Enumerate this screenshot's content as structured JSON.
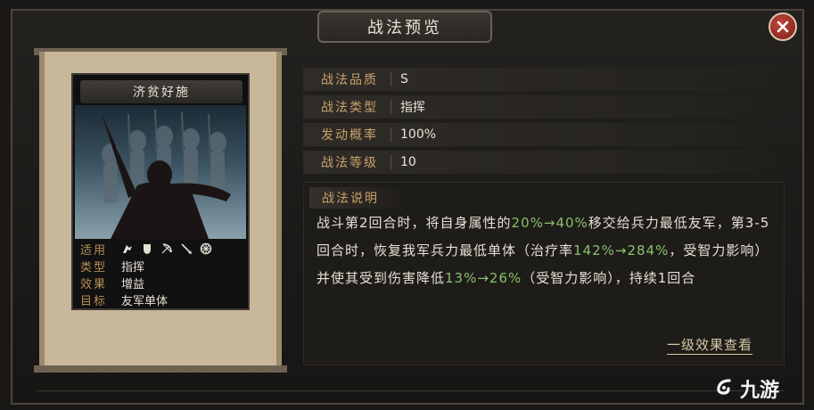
{
  "window": {
    "title": "战法预览"
  },
  "card": {
    "name": "济贫好施",
    "info": [
      {
        "key": "适用",
        "value": ""
      },
      {
        "key": "类型",
        "value": "指挥"
      },
      {
        "key": "效果",
        "value": "增益"
      },
      {
        "key": "目标",
        "value": "友军单体"
      }
    ],
    "applicable_icons": [
      "cavalry-icon",
      "shield-icon",
      "bow-icon",
      "spear-icon",
      "wheel-icon"
    ]
  },
  "details": [
    {
      "label": "战法品质",
      "value": "S"
    },
    {
      "label": "战法类型",
      "value": "指挥"
    },
    {
      "label": "发动概率",
      "value": "100%"
    },
    {
      "label": "战法等级",
      "value": "10"
    }
  ],
  "description": {
    "title": "战法说明",
    "segments": [
      {
        "t": "战斗第2回合时，将自身属性的",
        "g": false
      },
      {
        "t": "20%→40%",
        "g": true
      },
      {
        "t": "移交给兵力最低友军，第3-5回合时，恢复我军兵力最低单体（治疗率",
        "g": false
      },
      {
        "t": "142%→284%",
        "g": true
      },
      {
        "t": "，受智力影响）并使其受到伤害降低",
        "g": false
      },
      {
        "t": "13%→26%",
        "g": true
      },
      {
        "t": "（受智力影响），持续1回合",
        "g": false
      }
    ]
  },
  "link": {
    "label": "一级效果查看"
  },
  "watermark": {
    "text": "九游"
  },
  "colors": {
    "accent": "#c9a26a",
    "highlight": "#88c06c",
    "close": "#b03a2e"
  }
}
